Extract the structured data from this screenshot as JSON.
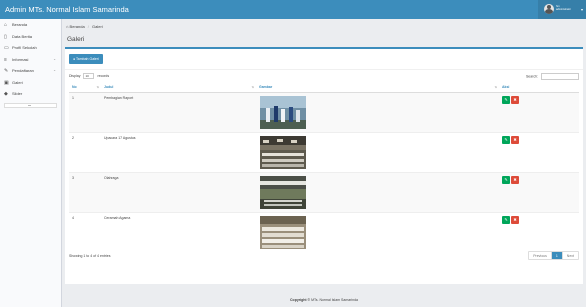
{
  "header": {
    "brand": "Admin MTs. Normal Islam Samarinda",
    "user_line_1": "hm",
    "user_line_2": "administrator"
  },
  "sidebar": {
    "items": [
      {
        "label": "Beranda",
        "icon": "home-icon"
      },
      {
        "label": "Data Berita",
        "icon": "file-icon"
      },
      {
        "label": "Profil Sekolah",
        "icon": "monitor-icon"
      },
      {
        "label": "Informasi",
        "icon": "list-icon"
      },
      {
        "label": "Pendaftaran",
        "icon": "edit-icon"
      },
      {
        "label": "Galeri",
        "icon": "image-icon"
      },
      {
        "label": "Slider",
        "icon": "tag-icon"
      }
    ]
  },
  "breadcrumb": {
    "home": "Beranda",
    "current": "Galeri"
  },
  "page_title": "Galeri",
  "box": {
    "add_button": "Tambah Galeri",
    "length_prefix": "Display",
    "length_value": "10",
    "length_suffix": "records",
    "search_label": "Search:"
  },
  "table": {
    "headers": {
      "no": "No",
      "judul": "Judul",
      "gambar": "Gambar",
      "aksi": "Aksi"
    },
    "rows": [
      {
        "no": "1",
        "judul": "Pembagian Raport",
        "thumb": "photo-group-outdoor"
      },
      {
        "no": "2",
        "judul": "Upacara 17 Agustus",
        "thumb": "photo-ceremony-crowd"
      },
      {
        "no": "3",
        "judul": "Olahraga",
        "thumb": "photo-school-field"
      },
      {
        "no": "4",
        "judul": "Ceramah Agama",
        "thumb": "photo-hall-audience"
      }
    ]
  },
  "info_text": "Showing 1 to 4 of 4 entries",
  "pagination": {
    "previous": "Previous",
    "page": "1",
    "next": "Next"
  },
  "footer": {
    "copyright": "Copyright ©",
    "text": "MTs. Normal Islam Samarinda"
  },
  "colors": {
    "primary": "#3c8dbc",
    "edit": "#00a65a",
    "delete": "#dd4b39"
  }
}
